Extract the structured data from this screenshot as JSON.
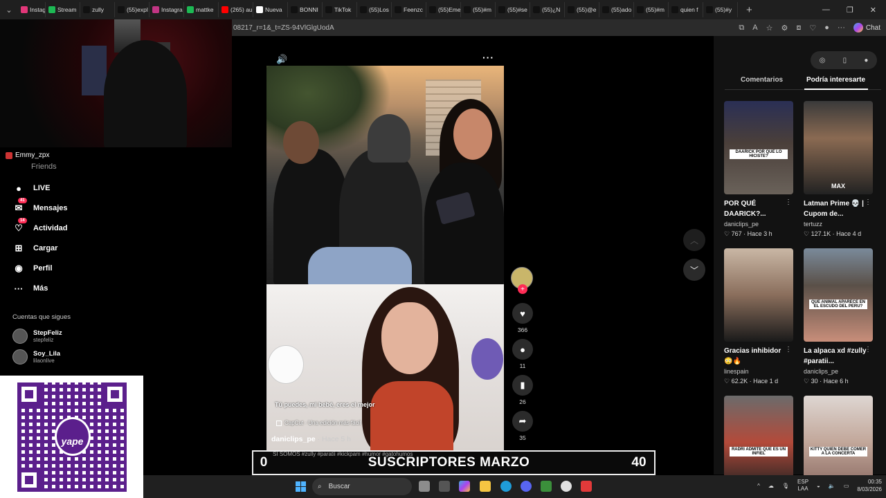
{
  "browser": {
    "tabs": [
      {
        "label": "Instagra",
        "color": "#e23779",
        "active": false
      },
      {
        "label": "Stream",
        "color": "#1db954",
        "active": false
      },
      {
        "label": "zully",
        "color": "#111111",
        "active": false
      },
      {
        "label": "(55)expl",
        "color": "#111111",
        "active": false
      },
      {
        "label": "Instagra",
        "color": "#c13584",
        "active": false
      },
      {
        "label": "mattke",
        "color": "#1db954",
        "active": false
      },
      {
        "label": "(265) au",
        "color": "#ff0000",
        "active": false
      },
      {
        "label": "Nueva",
        "color": "#ffffff",
        "active": false
      },
      {
        "label": "BONNI",
        "color": "#111111",
        "active": false
      },
      {
        "label": "TikTok",
        "color": "#111111",
        "active": false
      },
      {
        "label": "(55)Los",
        "color": "#111111",
        "active": false
      },
      {
        "label": "Feenzc",
        "color": "#111111",
        "active": false
      },
      {
        "label": "(55)Eme",
        "color": "#111111",
        "active": false
      },
      {
        "label": "(55)#m",
        "color": "#111111",
        "active": false
      },
      {
        "label": "(55)#se",
        "color": "#111111",
        "active": false
      },
      {
        "label": "(55)¿N",
        "color": "#111111",
        "active": false
      },
      {
        "label": "(55)@e",
        "color": "#111111",
        "active": false
      },
      {
        "label": "(55)ado",
        "color": "#111111",
        "active": false
      },
      {
        "label": "(55)#m",
        "color": "#111111",
        "active": false
      },
      {
        "label": "quien f",
        "color": "#111111",
        "active": false
      },
      {
        "label": "(55)#y",
        "color": "#111111",
        "active": false
      }
    ],
    "url": "08217_r=1&_t=ZS-94VlGlgUodA",
    "chat_label": "Chat"
  },
  "sidebar": {
    "stream_user": "Emmy_zpx",
    "friends": "Friends",
    "items": [
      {
        "label": "LIVE",
        "icon": "live-icon",
        "glyph": "●",
        "badge": ""
      },
      {
        "label": "Mensajes",
        "icon": "messages-icon",
        "glyph": "✉",
        "badge": "41"
      },
      {
        "label": "Actividad",
        "icon": "activity-icon",
        "glyph": "♡",
        "badge": "14"
      },
      {
        "label": "Cargar",
        "icon": "upload-icon",
        "glyph": "⊞",
        "badge": ""
      },
      {
        "label": "Perfil",
        "icon": "profile-icon",
        "glyph": "◉",
        "badge": ""
      },
      {
        "label": "Más",
        "icon": "more-icon",
        "glyph": "···",
        "badge": ""
      }
    ],
    "following_header": "Cuentas que sigues",
    "following": [
      {
        "name": "StepFeliz",
        "handle": "stepfeliz"
      },
      {
        "name": "Soy_Lila",
        "handle": "lilaonlive"
      }
    ]
  },
  "qr": {
    "brand": "yape"
  },
  "video": {
    "caption": "Tú puedes, mi bebé, eres el mejor",
    "capcut": "CapCut · Una edición más fácil",
    "author": "daniclips_pe",
    "time": " · Hace 5 h",
    "likes": "366",
    "comments": "11",
    "saves": "26",
    "shares": "35"
  },
  "right_panel": {
    "tab_comments": "Comentarios",
    "tab_suggested": "Podría interesarte",
    "cards": [
      {
        "title": "POR QUÉ DAARICK?...",
        "user": "daniclips_pe",
        "likes": "767",
        "time": "Hace 3 h",
        "thumb_label": "DAARICK POR QUE LO HICISTE?",
        "bg": "linear-gradient(180deg,#2a2f55 0,#4a3f3a 45%,#6a625a 100%)"
      },
      {
        "title": "Latman Prime 💀 | Cupom de...",
        "user": "tertuzz",
        "likes": "127.1K",
        "time": "Hace 4 d",
        "thumb_label": "MAX",
        "bg": "linear-gradient(180deg,#3a3a3a 0,#8a6a52 40%,#222 100%)"
      },
      {
        "title": "Gracias inhibidor 😳🔥",
        "user": "linespain",
        "likes": "62.2K",
        "time": "Hace 1 d",
        "thumb_label": "",
        "bg": "linear-gradient(180deg,#c9b7a5 0,#8a6e5c 50%,#1a1a1a 100%)"
      },
      {
        "title": "La alpaca xd #zully #paratii...",
        "user": "daniclips_pe",
        "likes": "30",
        "time": "Hace 6 h",
        "thumb_label": "QUE ANIMAL APARECE EN EL ESCUDO DEL PERU?",
        "bg": "linear-gradient(180deg,#7a8a9a 0,#5a5048 40%,#c88e7a 100%)"
      },
      {
        "title": "",
        "user": "",
        "likes": "",
        "time": "",
        "thumb_label": "RADRI ADMITE QUE ES UN INFIEL",
        "bg": "linear-gradient(180deg,#6b6b6b 0,#b34a3a 50%,#222 100%)"
      },
      {
        "title": "",
        "user": "",
        "likes": "",
        "time": "",
        "thumb_label": "KITTY QUIEN DEBE COMER A LA CONCERTA",
        "bg": "linear-gradient(180deg,#ded6d2 0,#c2a79a 50%,#8a6a62 100%)"
      }
    ]
  },
  "overlay": {
    "left_num": "0",
    "title": "SUSCRIPTORES MARZO",
    "right_num": "40",
    "ticker": "SI SOMOS #zully #paratii #kickpam #humor #gatohumos"
  },
  "taskbar": {
    "search_label": "Buscar",
    "lang_top": "ESP",
    "lang_bottom": "LAA",
    "time": "00:35",
    "date": "8/03/2026"
  }
}
